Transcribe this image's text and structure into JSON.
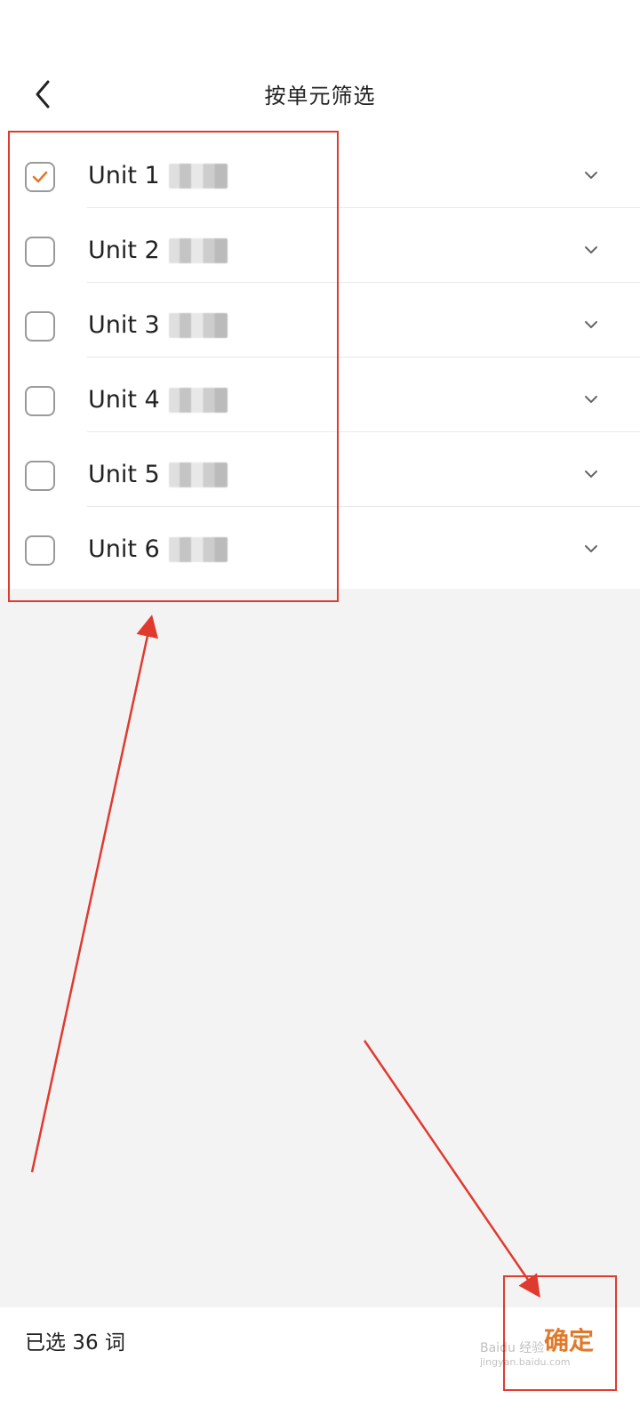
{
  "header": {
    "title": "按单元筛选",
    "back_icon": "chevron-left-icon"
  },
  "units": [
    {
      "label": "Unit 1",
      "checked": true
    },
    {
      "label": "Unit 2",
      "checked": false
    },
    {
      "label": "Unit 3",
      "checked": false
    },
    {
      "label": "Unit 4",
      "checked": false
    },
    {
      "label": "Unit 5",
      "checked": false
    },
    {
      "label": "Unit 6",
      "checked": false
    }
  ],
  "footer": {
    "selected_text": "已选 36 词",
    "confirm_label": "确定"
  },
  "watermark": {
    "text": "Baidu 经验",
    "sub": "jingyan.baidu.com"
  },
  "colors": {
    "accent": "#e07a2a",
    "annotation": "#e03a2f",
    "background": "#f3f3f3"
  }
}
